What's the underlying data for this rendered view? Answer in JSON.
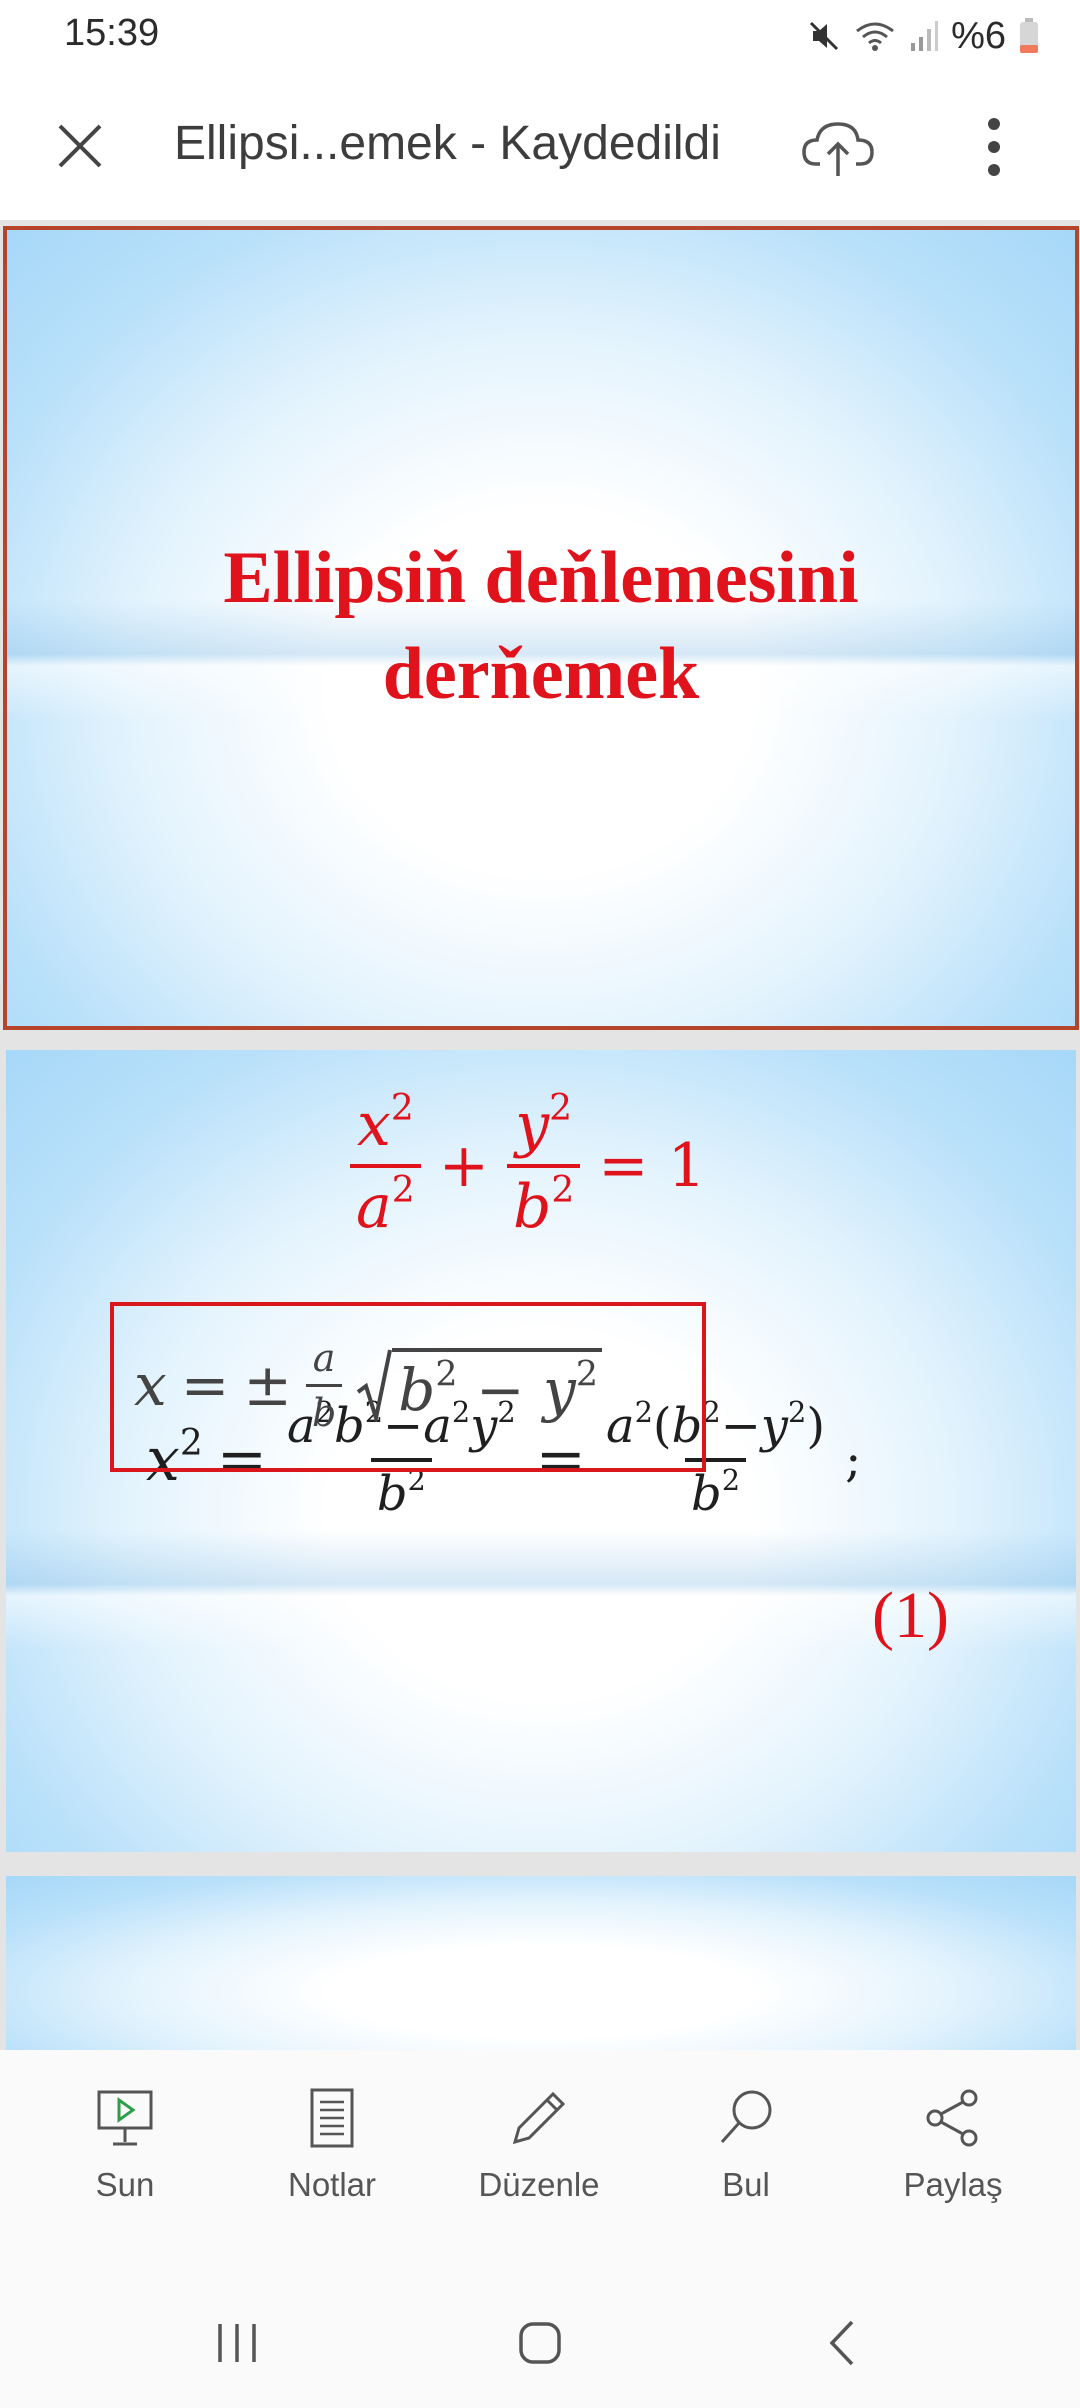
{
  "status_bar": {
    "time": "15:39",
    "battery": "%6",
    "icons": [
      "mute-icon",
      "wifi-icon",
      "signal-icon",
      "battery-icon"
    ]
  },
  "app_bar": {
    "title": "Ellipsi...emek - Kaydedildi",
    "icons": [
      "close-icon",
      "cloud-upload-icon",
      "more-vertical-icon"
    ]
  },
  "slides": {
    "slide1": {
      "title_line1": "Ellipsiň deňlemesini",
      "title_line2": "derňemek"
    },
    "slide2": {
      "equation_main": "x²/a² + y²/b² = 1",
      "equation_expanded": "x² = (a²b²−a²y²)/b² = a²(b²−y²)/b²;",
      "equation_boxed": "x = ± (a/b)√(b² − y²)",
      "equation_number": "(1)"
    }
  },
  "toolbar": {
    "items": [
      {
        "label": "Sun",
        "icon": "present-icon"
      },
      {
        "label": "Notlar",
        "icon": "notes-icon"
      },
      {
        "label": "Düzenle",
        "icon": "pencil-icon"
      },
      {
        "label": "Bul",
        "icon": "search-icon"
      },
      {
        "label": "Paylaş",
        "icon": "share-icon"
      }
    ]
  },
  "nav_bar": {
    "icons": [
      "recent-apps-icon",
      "home-icon",
      "back-icon"
    ]
  },
  "colors": {
    "accent_red": "#e0121b",
    "slide_border": "#b5442b",
    "slide_blue": "#a6d8f8"
  }
}
